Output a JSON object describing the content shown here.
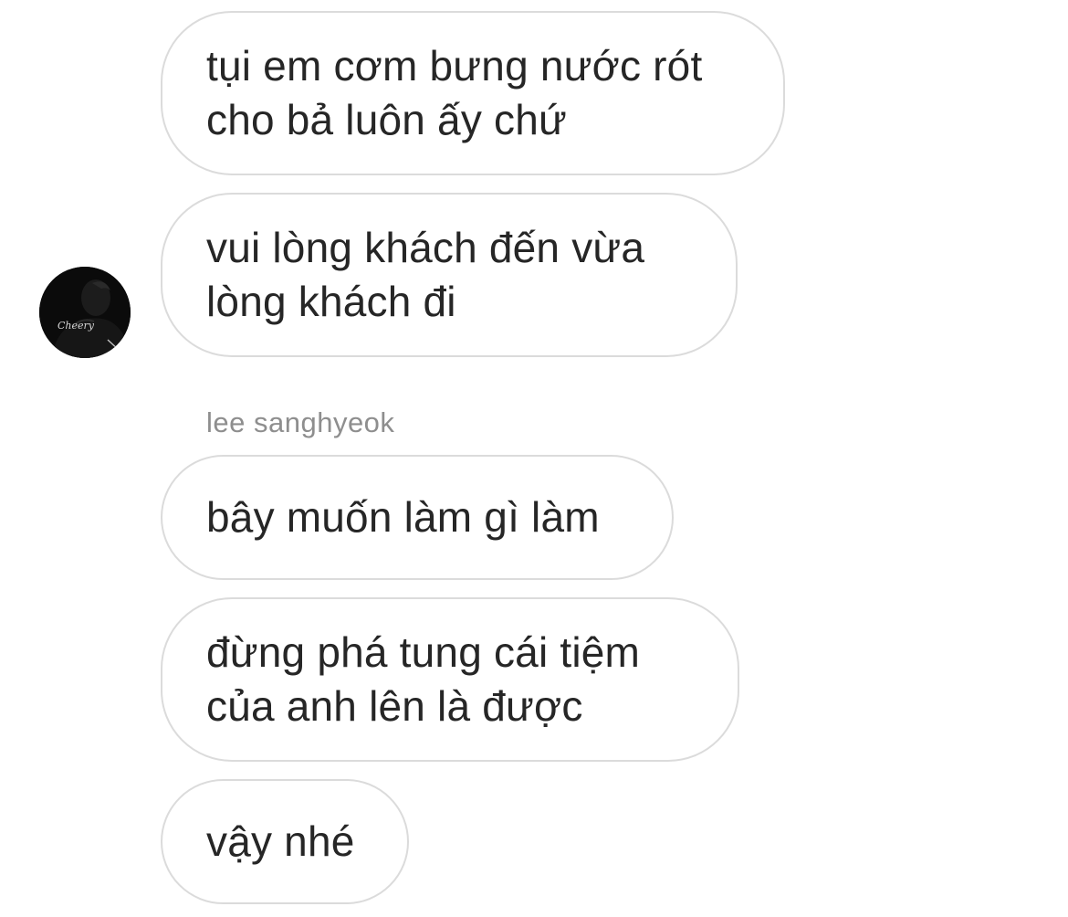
{
  "messages_before": [
    {
      "text": "tụi em cơm bưng nước rót\ncho bả luôn ấy chứ"
    },
    {
      "text": "vui lòng khách đến vừa\nlòng khách đi"
    }
  ],
  "sender": {
    "name": "lee sanghyeok",
    "avatar_icon": "profile-photo-avatar"
  },
  "messages_after": [
    {
      "text": "bây muốn làm gì làm"
    },
    {
      "text": "đừng phá tung cái tiệm\ncủa anh lên là được"
    },
    {
      "text": "vậy nhé"
    }
  ],
  "colors": {
    "background": "#ffffff",
    "bubble_border": "#dbdbdb",
    "message_text": "#262626",
    "sender_name": "#8e8e8e"
  }
}
